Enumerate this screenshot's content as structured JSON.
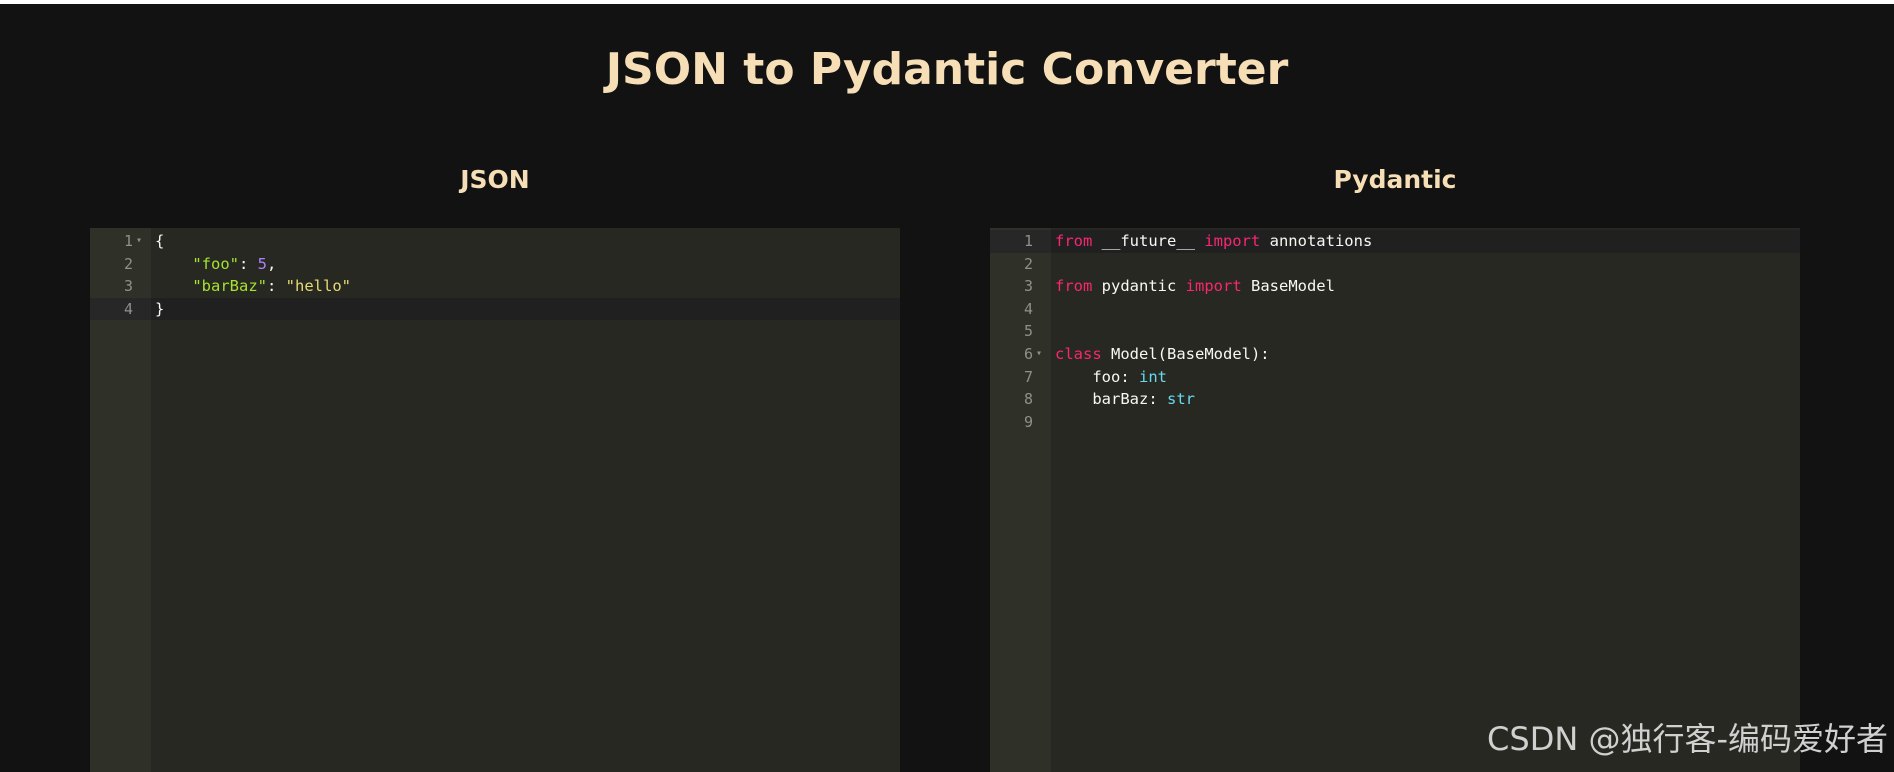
{
  "page": {
    "title": "JSON to Pydantic Converter"
  },
  "left_panel": {
    "heading": "JSON",
    "active_line": 4,
    "lines": [
      {
        "n": "1",
        "fold": true,
        "tokens": [
          {
            "t": "{",
            "c": "plain"
          }
        ]
      },
      {
        "n": "2",
        "fold": false,
        "tokens": [
          {
            "t": "    ",
            "c": "plain"
          },
          {
            "t": "\"foo\"",
            "c": "key"
          },
          {
            "t": ": ",
            "c": "plain"
          },
          {
            "t": "5",
            "c": "num"
          },
          {
            "t": ",",
            "c": "plain"
          }
        ]
      },
      {
        "n": "3",
        "fold": false,
        "tokens": [
          {
            "t": "    ",
            "c": "plain"
          },
          {
            "t": "\"barBaz\"",
            "c": "key"
          },
          {
            "t": ": ",
            "c": "plain"
          },
          {
            "t": "\"hello\"",
            "c": "str"
          }
        ]
      },
      {
        "n": "4",
        "fold": false,
        "tokens": [
          {
            "t": "}",
            "c": "plain"
          }
        ]
      }
    ]
  },
  "right_panel": {
    "heading": "Pydantic",
    "active_line": 1,
    "lines": [
      {
        "n": "1",
        "fold": false,
        "tokens": [
          {
            "t": "from",
            "c": "kw"
          },
          {
            "t": " __future__ ",
            "c": "plain"
          },
          {
            "t": "import",
            "c": "kw"
          },
          {
            "t": " annotations",
            "c": "plain"
          }
        ]
      },
      {
        "n": "2",
        "fold": false,
        "tokens": []
      },
      {
        "n": "3",
        "fold": false,
        "tokens": [
          {
            "t": "from",
            "c": "kw"
          },
          {
            "t": " pydantic ",
            "c": "plain"
          },
          {
            "t": "import",
            "c": "kw"
          },
          {
            "t": " BaseModel",
            "c": "plain"
          }
        ]
      },
      {
        "n": "4",
        "fold": false,
        "tokens": []
      },
      {
        "n": "5",
        "fold": false,
        "tokens": []
      },
      {
        "n": "6",
        "fold": true,
        "tokens": [
          {
            "t": "class",
            "c": "kw"
          },
          {
            "t": " Model(BaseModel):",
            "c": "plain"
          }
        ]
      },
      {
        "n": "7",
        "fold": false,
        "tokens": [
          {
            "t": "    foo: ",
            "c": "plain"
          },
          {
            "t": "int",
            "c": "type"
          }
        ]
      },
      {
        "n": "8",
        "fold": false,
        "tokens": [
          {
            "t": "    barBaz: ",
            "c": "plain"
          },
          {
            "t": "str",
            "c": "type"
          }
        ]
      },
      {
        "n": "9",
        "fold": false,
        "tokens": []
      }
    ]
  },
  "watermark": "CSDN @独行客-编码爱好者",
  "colors": {
    "title": "#f6deb6",
    "editor_bg": "#272822",
    "gutter_bg": "#2f3129",
    "keyword": "#f92672",
    "string": "#e6db74",
    "json_key": "#a6e22e",
    "number": "#ae81ff",
    "type": "#66d9ef"
  }
}
